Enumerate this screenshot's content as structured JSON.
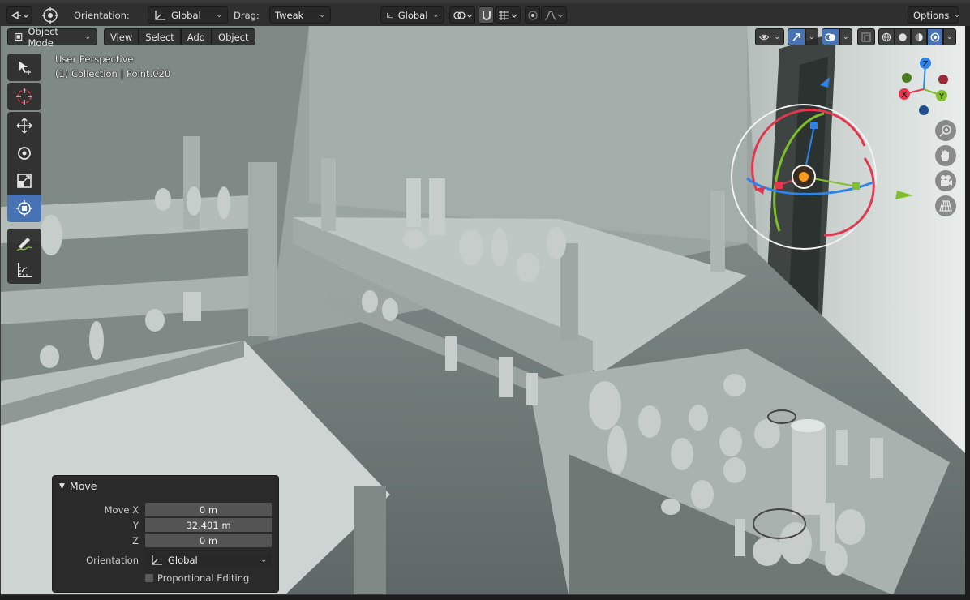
{
  "header": {
    "orientation_label": "Orientation:",
    "orientation_value": "Global",
    "drag_label": "Drag:",
    "drag_value": "Tweak",
    "pivot_orientation_value": "Global",
    "options_label": "Options"
  },
  "viewport_header": {
    "mode": "Object Mode",
    "menus": [
      "View",
      "Select",
      "Add",
      "Object"
    ]
  },
  "overlay": {
    "perspective": "User Perspective",
    "collection_info": "(1) Collection | Point.020"
  },
  "gizmo": {
    "axes": {
      "z": "Z",
      "x": "X",
      "y": "Y"
    },
    "colors": {
      "x": "#e2384f",
      "y": "#7fbf2a",
      "z": "#2f83e6"
    }
  },
  "tools": [
    {
      "name": "select-tool-icon",
      "active": false
    },
    {
      "name": "cursor-tool-icon",
      "active": false
    },
    {
      "name": "move-tool-icon",
      "active": false
    },
    {
      "name": "rotate-tool-icon",
      "active": false
    },
    {
      "name": "scale-tool-icon",
      "active": false
    },
    {
      "name": "transform-tool-icon",
      "active": true
    },
    {
      "name": "annotate-tool-icon",
      "active": false
    },
    {
      "name": "measure-tool-icon",
      "active": false
    }
  ],
  "operator_panel": {
    "title": "Move",
    "move_x_label": "Move X",
    "move_x_value": "0 m",
    "y_label": "Y",
    "y_value": "32.401 m",
    "z_label": "Z",
    "z_value": "0 m",
    "orientation_label": "Orientation",
    "orientation_value": "Global",
    "proportional_label": "Proportional Editing",
    "proportional_checked": false
  },
  "theme": {
    "accent": "#4772b3",
    "header_bg": "#2f2f2f",
    "panel_bg": "#242424"
  }
}
